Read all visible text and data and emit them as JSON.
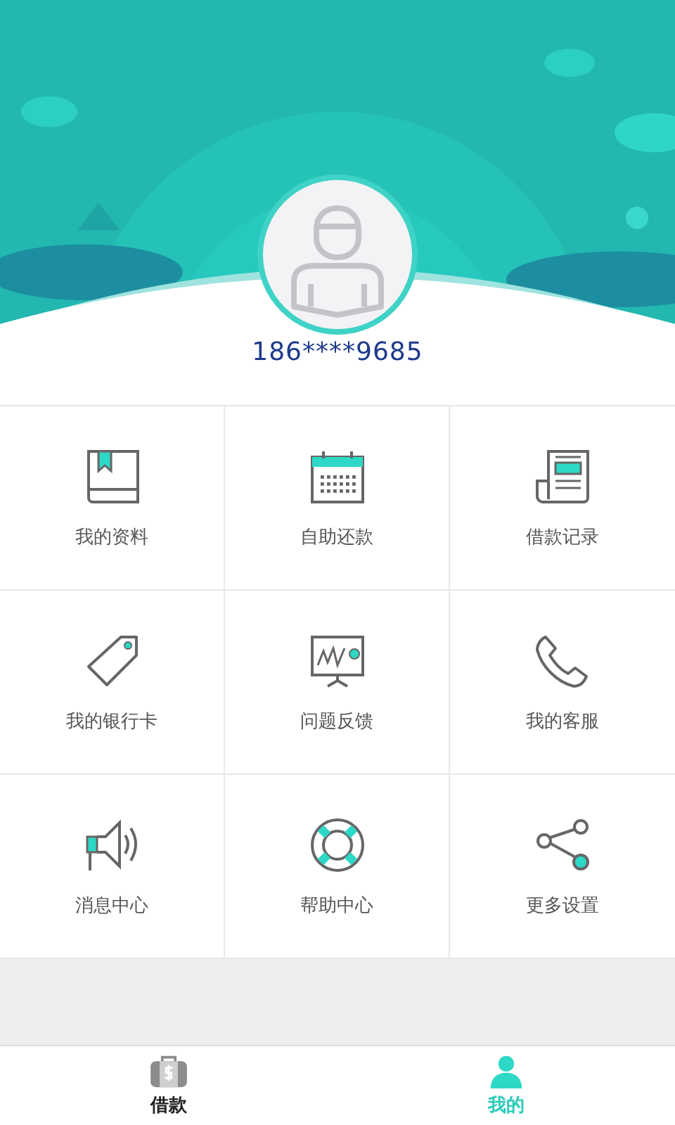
{
  "profile": {
    "phone": "186****9685"
  },
  "menu": [
    {
      "label": "我的资料"
    },
    {
      "label": "自助还款"
    },
    {
      "label": "借款记录"
    },
    {
      "label": "我的银行卡"
    },
    {
      "label": "问题反馈"
    },
    {
      "label": "我的客服"
    },
    {
      "label": "消息中心"
    },
    {
      "label": "帮助中心"
    },
    {
      "label": "更多设置"
    }
  ],
  "tabs": [
    {
      "label": "借款",
      "selected": false
    },
    {
      "label": "我的",
      "selected": true
    }
  ]
}
